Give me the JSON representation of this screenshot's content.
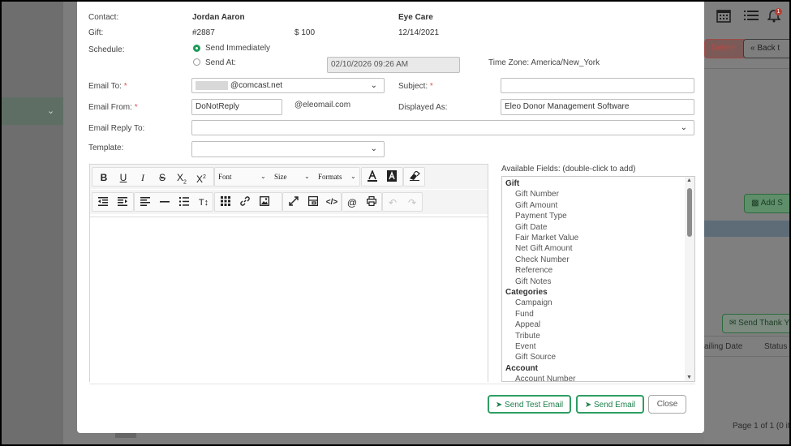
{
  "background": {
    "buttons": {
      "delete": "Delete",
      "back": "Back t",
      "add": "Add S",
      "send_thank": "Send Thank Y"
    },
    "table_headers": {
      "mailing_date": "ailing Date",
      "status": "Status"
    },
    "pagination": "Page 1 of 1 (0 it",
    "notification_count": "1"
  },
  "header": {
    "contact_label": "Contact:",
    "contact_value": "Jordan Aaron",
    "organization": "Eye Care",
    "gift_label": "Gift:",
    "gift_number": "#2887",
    "gift_amount": "$ 100",
    "gift_date": "12/14/2021"
  },
  "schedule": {
    "label": "Schedule:",
    "option_immediate": "Send Immediately",
    "option_at": "Send At:",
    "selected": "Send Immediately",
    "datetime": "02/10/2026 09:26  AM",
    "timezone": "Time Zone: America/New_York"
  },
  "form": {
    "email_to_label": "Email To:",
    "email_to_value": "@comcast.net",
    "subject_label": "Subject:",
    "subject_value": "",
    "email_from_label": "Email From:",
    "email_from_value": "DoNotReply",
    "email_domain": "@eleomail.com",
    "displayed_as_label": "Displayed As:",
    "displayed_as_value": "Eleo Donor Management Software",
    "reply_to_label": "Email Reply To:",
    "reply_to_value": "",
    "template_label": "Template:",
    "template_value": "",
    "required_mark": "*"
  },
  "toolbar": {
    "font": "Font",
    "size": "Size",
    "formats": "Formats"
  },
  "available_fields": {
    "title": "Available Fields: (double-click to add)",
    "groups": [
      {
        "name": "Gift",
        "items": [
          "Gift Number",
          "Gift Amount",
          "Payment Type",
          "Gift Date",
          "Fair Market Value",
          "Net Gift Amount",
          "Check Number",
          "Reference",
          "Gift Notes"
        ]
      },
      {
        "name": "Categories",
        "items": [
          "Campaign",
          "Fund",
          "Appeal",
          "Tribute",
          "Event",
          "Gift Source"
        ]
      },
      {
        "name": "Account",
        "items": [
          "Account Number"
        ]
      }
    ]
  },
  "actions": {
    "send_test": "Send Test Email",
    "send": "Send Email",
    "close": "Close"
  },
  "colors": {
    "accent": "#2e9e62",
    "required": "#d9534f"
  }
}
